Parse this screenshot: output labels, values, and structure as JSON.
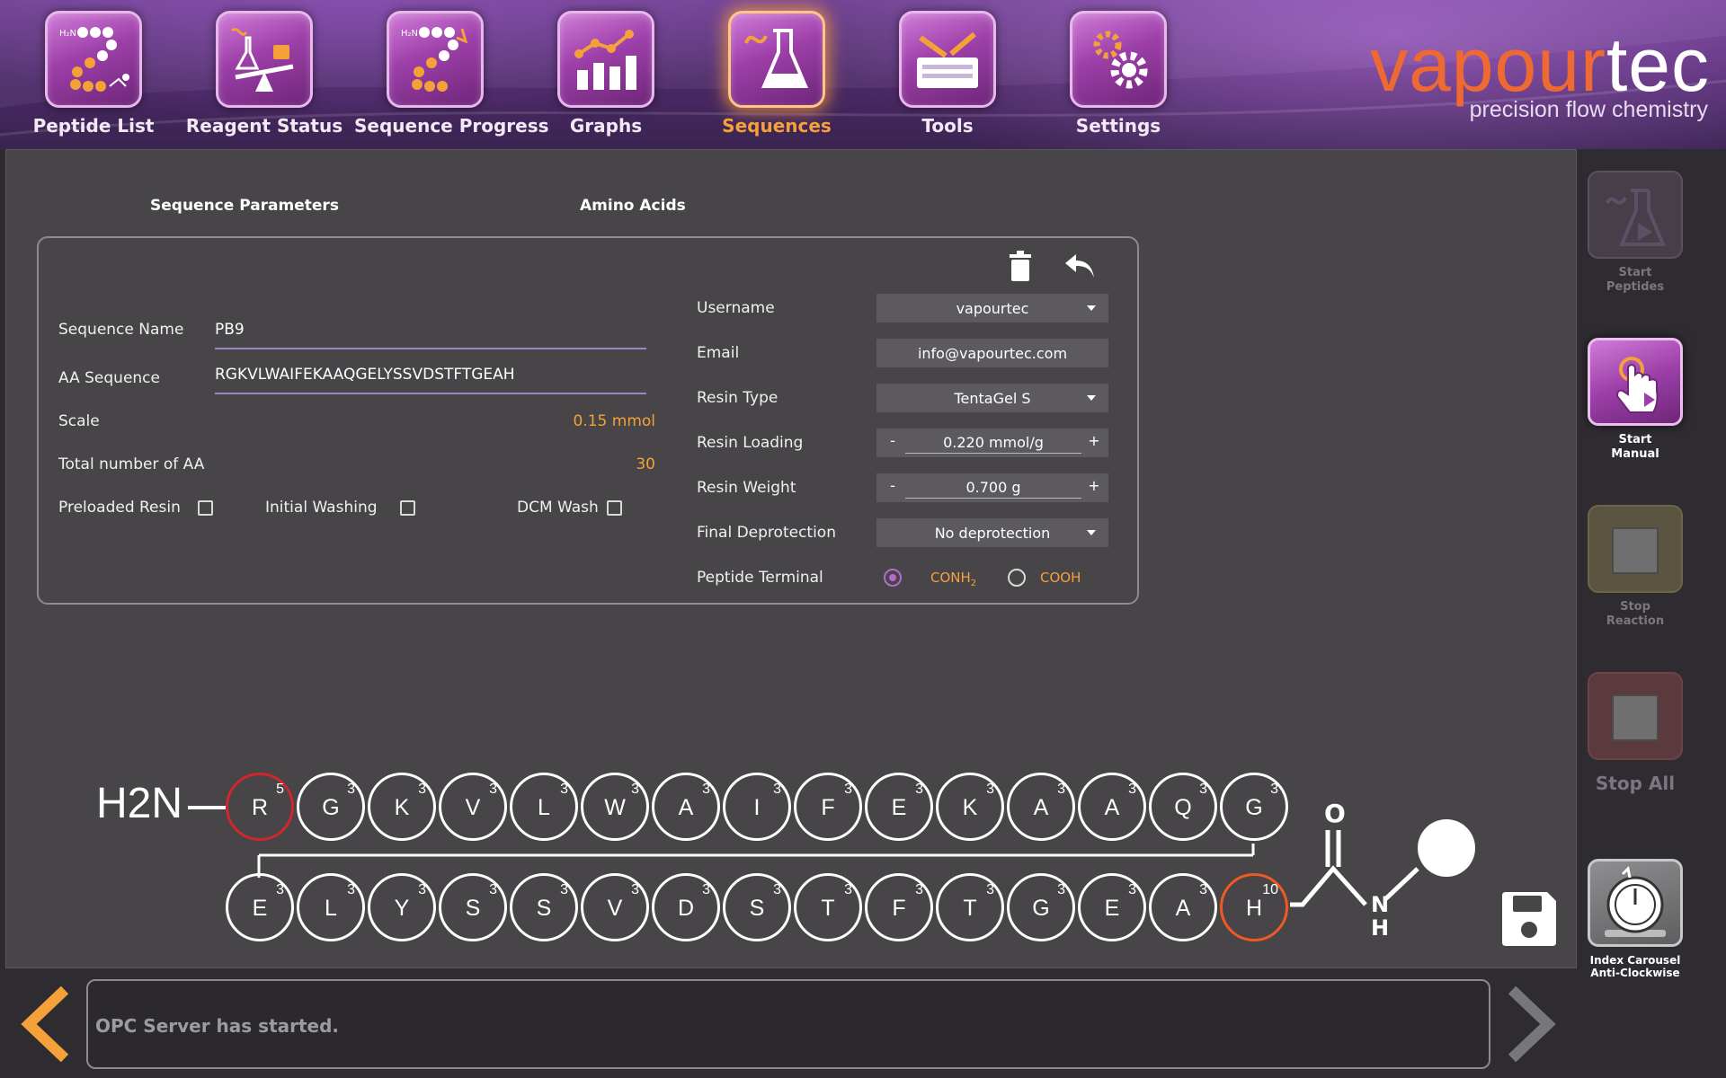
{
  "nav": {
    "items": [
      {
        "label": "Peptide List",
        "icon": "peptide-list-icon"
      },
      {
        "label": "Reagent Status",
        "icon": "reagent-status-icon"
      },
      {
        "label": "Sequence Progress",
        "icon": "sequence-progress-icon"
      },
      {
        "label": "Graphs",
        "icon": "graphs-icon"
      },
      {
        "label": "Sequences",
        "icon": "sequences-icon",
        "active": true
      },
      {
        "label": "Tools",
        "icon": "tools-icon"
      },
      {
        "label": "Settings",
        "icon": "settings-icon"
      }
    ]
  },
  "brand": {
    "name_part1": "vapour",
    "name_part2": "tec",
    "tagline": "precision flow chemistry"
  },
  "tabs": {
    "params": "Sequence Parameters",
    "amino": "Amino Acids"
  },
  "form": {
    "sequence_name_label": "Sequence Name",
    "sequence_name_value": "PB9",
    "aa_sequence_label": "AA Sequence",
    "aa_sequence_value": "RGKVLWAIFEKAAQGELYSSVDSTFTGEAH",
    "scale_label": "Scale",
    "scale_value": "0.15 mmol",
    "total_label": "Total number of AA",
    "total_value": "30",
    "preloaded_label": "Preloaded Resin",
    "initial_wash_label": "Initial Washing",
    "dcm_wash_label": "DCM Wash",
    "username_label": "Username",
    "username_value": "vapourtec",
    "email_label": "Email",
    "email_value": "info@vapourtec.com",
    "resin_type_label": "Resin Type",
    "resin_type_value": "TentaGel S",
    "resin_loading_label": "Resin Loading",
    "resin_loading_value": "0.220 mmol/g",
    "resin_weight_label": "Resin Weight",
    "resin_weight_value": "0.700 g",
    "final_deprot_label": "Final Deprotection",
    "final_deprot_value": "No deprotection",
    "terminal_label": "Peptide Terminal",
    "terminal_opt1": "CONH",
    "terminal_opt1_sub": "2",
    "terminal_opt2": "COOH",
    "minus": "-",
    "plus": "+"
  },
  "sequence": {
    "h2n": "H2N",
    "top_row": [
      {
        "aa": "R",
        "count": "5"
      },
      {
        "aa": "G",
        "count": "3"
      },
      {
        "aa": "K",
        "count": "3"
      },
      {
        "aa": "V",
        "count": "3"
      },
      {
        "aa": "L",
        "count": "3"
      },
      {
        "aa": "W",
        "count": "3"
      },
      {
        "aa": "A",
        "count": "3"
      },
      {
        "aa": "I",
        "count": "3"
      },
      {
        "aa": "F",
        "count": "3"
      },
      {
        "aa": "E",
        "count": "3"
      },
      {
        "aa": "K",
        "count": "3"
      },
      {
        "aa": "A",
        "count": "3"
      },
      {
        "aa": "A",
        "count": "3"
      },
      {
        "aa": "Q",
        "count": "3"
      },
      {
        "aa": "G",
        "count": "3"
      }
    ],
    "bottom_row": [
      {
        "aa": "E",
        "count": "3"
      },
      {
        "aa": "L",
        "count": "3"
      },
      {
        "aa": "Y",
        "count": "3"
      },
      {
        "aa": "S",
        "count": "3"
      },
      {
        "aa": "S",
        "count": "3"
      },
      {
        "aa": "V",
        "count": "3"
      },
      {
        "aa": "D",
        "count": "3"
      },
      {
        "aa": "S",
        "count": "3"
      },
      {
        "aa": "T",
        "count": "3"
      },
      {
        "aa": "F",
        "count": "3"
      },
      {
        "aa": "T",
        "count": "3"
      },
      {
        "aa": "G",
        "count": "3"
      },
      {
        "aa": "E",
        "count": "3"
      },
      {
        "aa": "A",
        "count": "3"
      },
      {
        "aa": "H",
        "count": "10"
      }
    ],
    "terminal_o": "O",
    "terminal_n": "N",
    "terminal_h": "H"
  },
  "side": {
    "start_peptides": [
      "Start",
      "Peptides"
    ],
    "start_manual": [
      "Start",
      "Manual"
    ],
    "stop_reaction": [
      "Stop",
      "Reaction"
    ],
    "stop_all": "Stop All",
    "index_carousel": [
      "Index Carousel",
      "Anti-Clockwise"
    ]
  },
  "status": {
    "message": "OPC Server has started."
  },
  "colors": {
    "accent_orange": "#f5a13a",
    "brand_purple": "#7b3f9e",
    "brand_orange": "#ef6a32"
  }
}
